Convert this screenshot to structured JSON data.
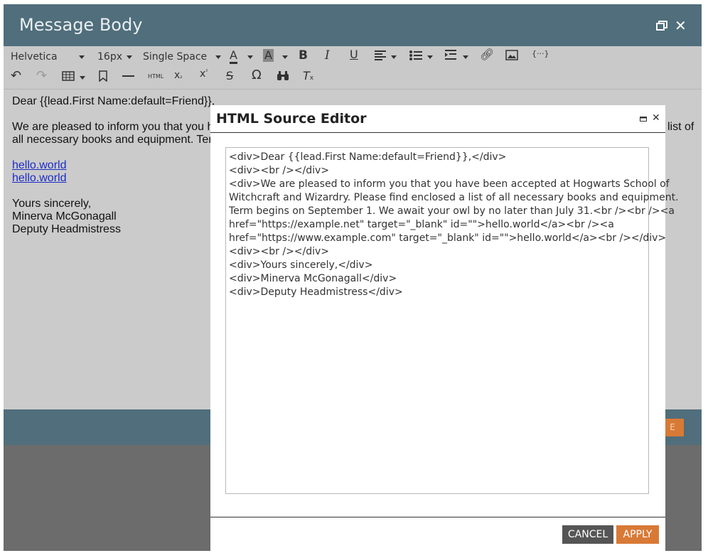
{
  "outer_dialog": {
    "title": "Message Body",
    "restore_icon": "restore-window-icon",
    "close_icon": "close-icon"
  },
  "toolbar": {
    "font_family": "Helvetica",
    "font_size": "16px",
    "line_spacing": "Single Space",
    "icons_row1": [
      "font-color-icon",
      "highlight-color-icon",
      "bold-icon",
      "italic-icon",
      "underline-icon",
      "align-icon",
      "bulleted-list-icon",
      "indent-icon",
      "link-icon",
      "image-icon",
      "token-icon"
    ],
    "icons_row2": [
      "undo-icon",
      "redo-icon",
      "table-icon",
      "bookmark-icon",
      "horizontal-rule-icon",
      "html-source-icon",
      "subscript-icon",
      "superscript-icon",
      "strikethrough-icon",
      "special-character-icon",
      "find-replace-icon",
      "clear-formatting-icon"
    ],
    "html_label": "HTML"
  },
  "content": {
    "line1": "Dear {{lead.First Name:default=Friend}},",
    "line2a": "We are pleased to inform you that you h",
    "line2b": "list of",
    "line3": "all necessary books and equipment. Term",
    "link1": "hello.world",
    "link2": "hello.world",
    "line4": "Yours sincerely,",
    "line5": "Minerva McGonagall",
    "line6": "Deputy Headmistress"
  },
  "outer_footer": {
    "button_fragment": "E"
  },
  "html_source_editor": {
    "title": "HTML Source Editor",
    "lines": [
      "<div>Dear {{lead.First Name:default=Friend}},</div>",
      "<div><br /></div>",
      "<div>We are pleased to inform you that you have been accepted at Hogwarts School of",
      "Witchcraft and Wizardry. Please find enclosed a list of all necessary books and equipment.",
      "Term begins on September 1. We await your owl by no later than July 31.<br /><br /><a",
      "href=\"https://example.net\" target=\"_blank\" id=\"\">hello.world</a><br /><a",
      "href=\"https://www.example.com\" target=\"_blank\" id=\"\">hello.world</a><br /></div>",
      "<div><br /></div>",
      "<div>Yours sincerely,</div>",
      "<div>Minerva McGonagall</div>",
      "<div>Deputy Headmistress</div>"
    ],
    "cancel_label": "CANCEL",
    "apply_label": "APPLY"
  }
}
